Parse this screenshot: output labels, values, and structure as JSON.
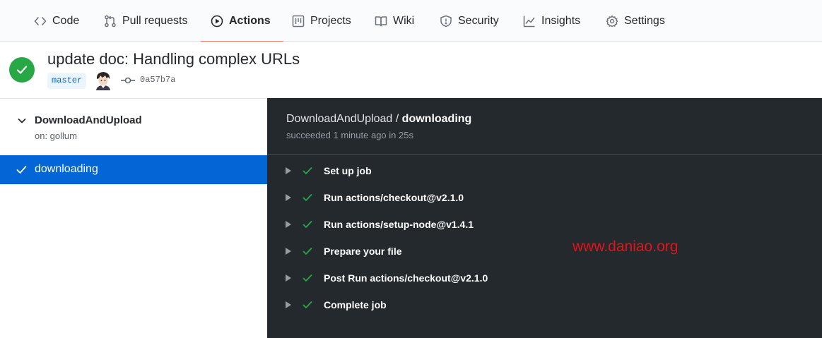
{
  "nav": {
    "tabs": [
      {
        "label": "Code",
        "icon": "code-icon"
      },
      {
        "label": "Pull requests",
        "icon": "pull-request-icon"
      },
      {
        "label": "Actions",
        "icon": "play-icon",
        "selected": true
      },
      {
        "label": "Projects",
        "icon": "project-icon"
      },
      {
        "label": "Wiki",
        "icon": "book-icon"
      },
      {
        "label": "Security",
        "icon": "shield-icon"
      },
      {
        "label": "Insights",
        "icon": "graph-icon"
      },
      {
        "label": "Settings",
        "icon": "gear-icon"
      }
    ]
  },
  "run": {
    "status": "success",
    "title": "update doc: Handling complex URLs",
    "branch": "master",
    "commit_sha": "0a57b7a"
  },
  "sidebar": {
    "workflow_name": "DownloadAndUpload",
    "trigger": "on: gollum",
    "jobs": [
      {
        "label": "downloading",
        "status": "success",
        "selected": true
      }
    ]
  },
  "log": {
    "workflow": "DownloadAndUpload",
    "separator": " / ",
    "job": "downloading",
    "status_text": "succeeded 1 minute ago in 25s",
    "steps": [
      {
        "label": "Set up job"
      },
      {
        "label": "Run actions/checkout@v2.1.0"
      },
      {
        "label": "Run actions/setup-node@v1.4.1"
      },
      {
        "label": "Prepare your file"
      },
      {
        "label": "Post Run actions/checkout@v2.1.0"
      },
      {
        "label": "Complete job"
      }
    ]
  },
  "watermark": "www.daniao.org",
  "colors": {
    "success": "#28a745",
    "selected_job_bg": "#0366d6",
    "nav_underline": "#f9826c",
    "log_bg": "#24292e",
    "watermark": "#e5121c"
  }
}
